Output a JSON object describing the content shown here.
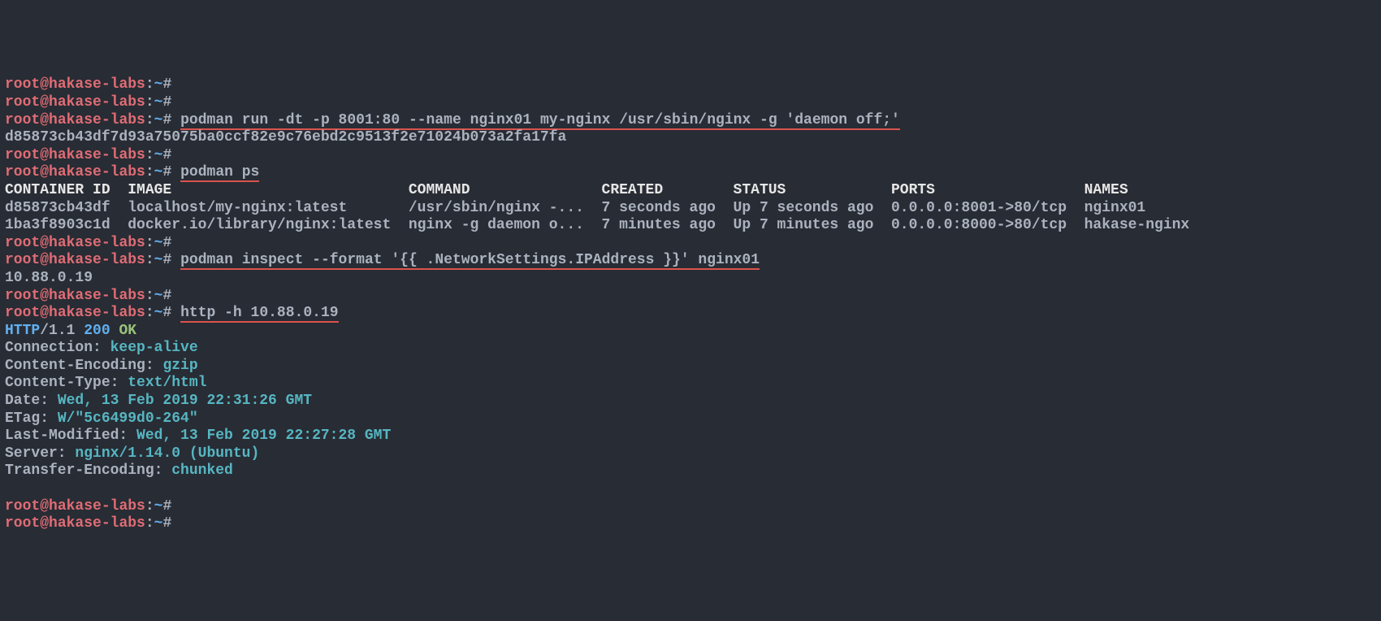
{
  "prompt": {
    "user": "root",
    "at": "@",
    "host": "hakase-labs",
    "colon": ":",
    "path": "~",
    "sym": "#"
  },
  "lines": {
    "cmd_run": "podman run -dt -p 8001:80 --name nginx01 my-nginx /usr/sbin/nginx -g 'daemon off;'",
    "hash_out": "d85873cb43df7d93a75075ba0ccf82e9c76ebd2c9513f2e71024b073a2fa17fa",
    "cmd_ps": "podman ps",
    "cmd_inspect": "podman inspect --format '{{ .NetworkSettings.IPAddress }}' nginx01",
    "ip_out": "10.88.0.19",
    "cmd_http": "http -h 10.88.0.19"
  },
  "ps_header": "CONTAINER ID  IMAGE                           COMMAND               CREATED        STATUS            PORTS                 NAMES",
  "ps_rows": [
    "d85873cb43df  localhost/my-nginx:latest       /usr/sbin/nginx -...  7 seconds ago  Up 7 seconds ago  0.0.0.0:8001->80/tcp  nginx01",
    "1ba3f8903c1d  docker.io/library/nginx:latest  nginx -g daemon o...  7 minutes ago  Up 7 minutes ago  0.0.0.0:8000->80/tcp  hakase-nginx"
  ],
  "http": {
    "proto": "HTTP",
    "slash": "/",
    "ver": "1.1 ",
    "code": "200 ",
    "ok": "OK",
    "headers": [
      {
        "k": "Connection: ",
        "v": "keep-alive"
      },
      {
        "k": "Content-Encoding: ",
        "v": "gzip"
      },
      {
        "k": "Content-Type: ",
        "v": "text/html"
      },
      {
        "k": "Date: ",
        "v": "Wed, 13 Feb 2019 22:31:26 GMT"
      },
      {
        "k": "ETag: ",
        "v": "W/\"5c6499d0-264\""
      },
      {
        "k": "Last-Modified: ",
        "v": "Wed, 13 Feb 2019 22:27:28 GMT"
      },
      {
        "k": "Server: ",
        "v": "nginx/1.14.0 (Ubuntu)"
      },
      {
        "k": "Transfer-Encoding: ",
        "v": "chunked"
      }
    ]
  }
}
